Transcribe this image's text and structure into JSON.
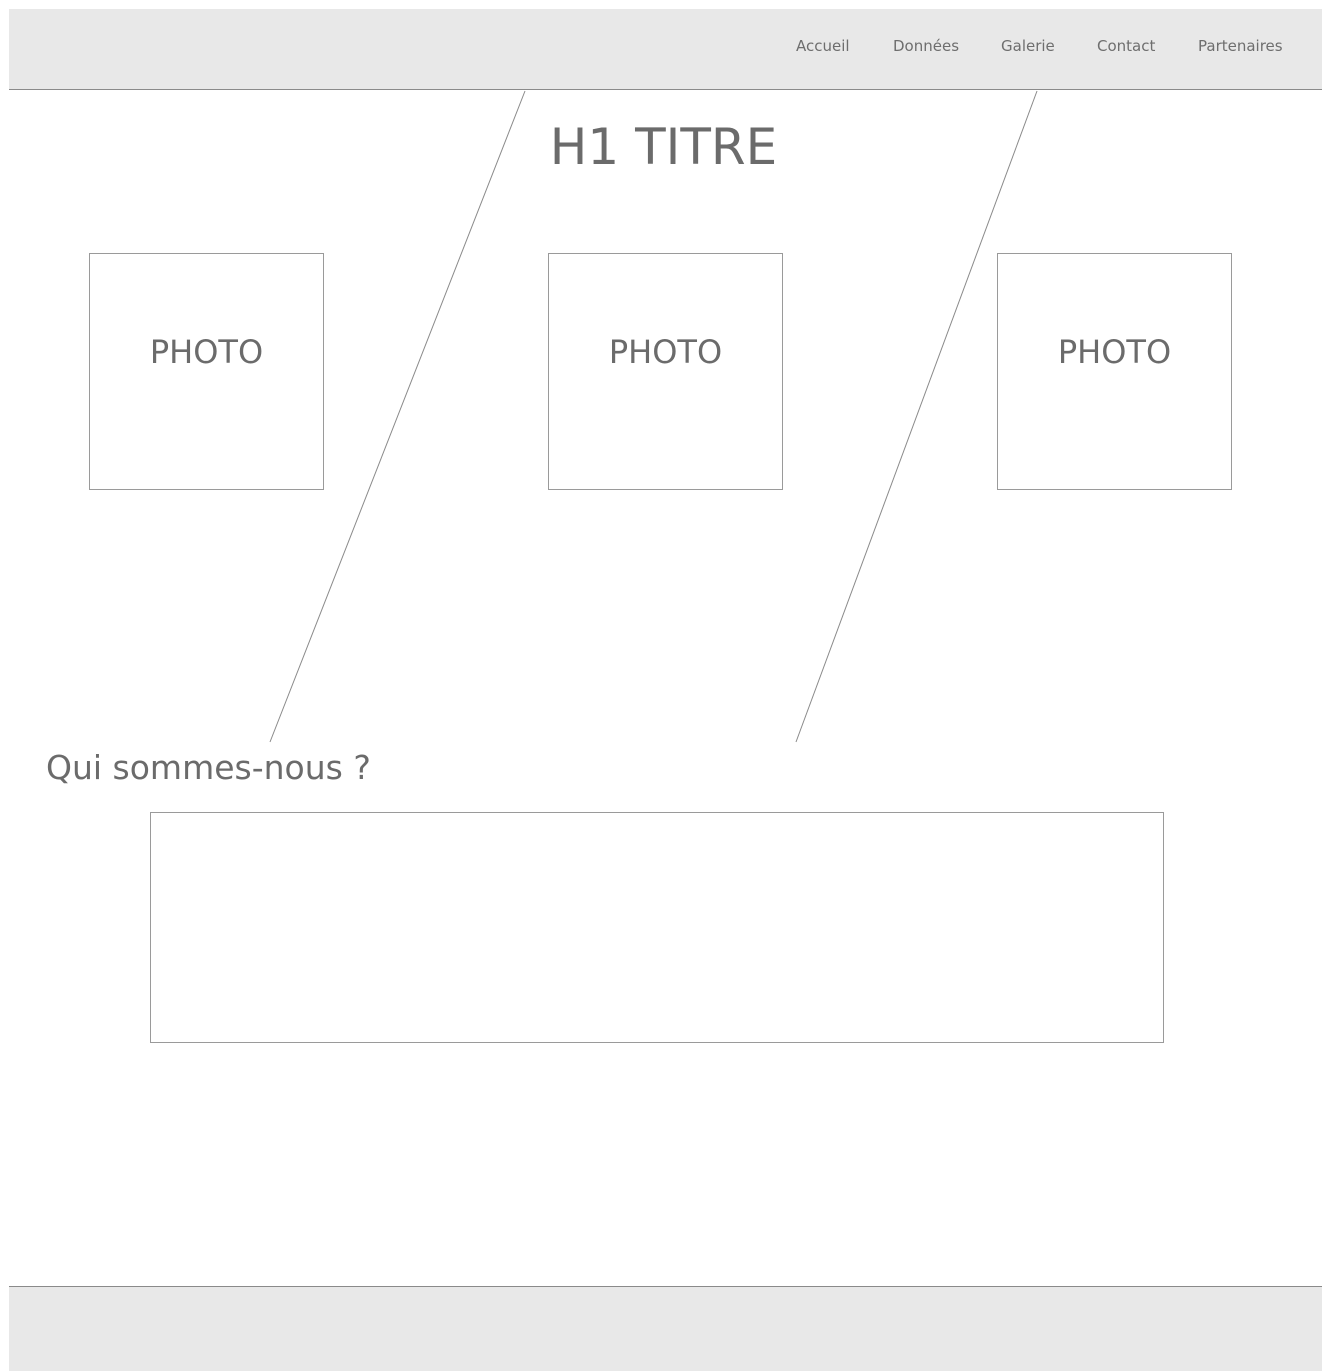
{
  "header": {
    "nav": [
      {
        "label": "Accueil"
      },
      {
        "label": "Données"
      },
      {
        "label": "Galerie"
      },
      {
        "label": "Contact"
      },
      {
        "label": "Partenaires"
      }
    ]
  },
  "main": {
    "title": "H1 TITRE",
    "photos": [
      {
        "label": "PHOTO"
      },
      {
        "label": "PHOTO"
      },
      {
        "label": "PHOTO"
      }
    ],
    "about": {
      "heading": "Qui sommes-nous ?",
      "text": ""
    }
  },
  "colors": {
    "header_bg": "#e8e8e8",
    "border": "#9a9a9a",
    "text": "#6b6b6b"
  }
}
